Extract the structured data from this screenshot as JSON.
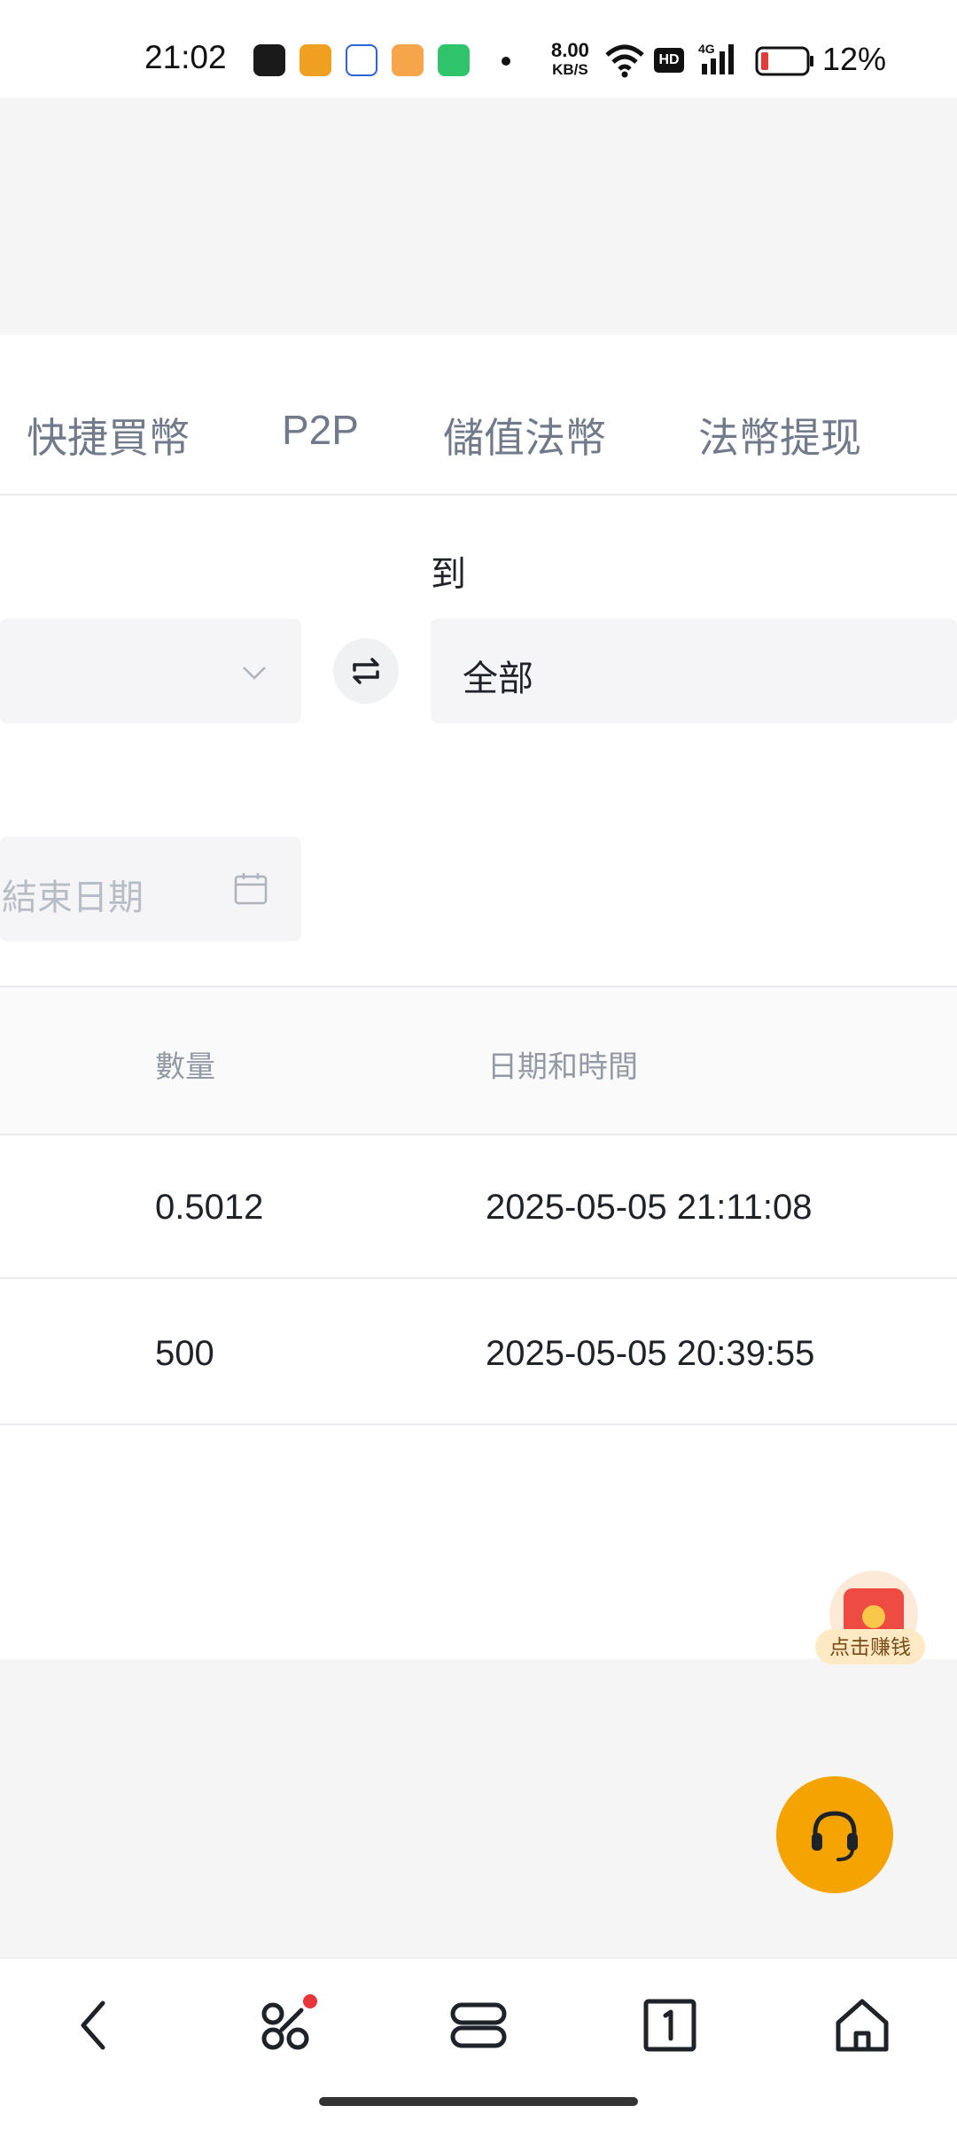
{
  "status_bar": {
    "time": "21:02",
    "net_speed_value": "8.00",
    "net_speed_unit": "KB/S",
    "battery_percent": "12%",
    "icons": [
      "app-icon-a",
      "app-icon-imou",
      "app-icon-c",
      "app-icon-video",
      "app-icon-battery-saver",
      "wifi-icon",
      "hd-icon",
      "4g-signal-icon",
      "battery-icon"
    ]
  },
  "tabs": [
    {
      "label": "快捷買幣"
    },
    {
      "label": "P2P"
    },
    {
      "label": "儲值法幣"
    },
    {
      "label": "法幣提现"
    }
  ],
  "form": {
    "to_label": "到",
    "to_value": "全部",
    "end_date_placeholder": "結束日期"
  },
  "table": {
    "headers": {
      "amount": "數量",
      "datetime": "日期和時間"
    },
    "rows": [
      {
        "amount": "0.5012",
        "datetime": "2025-05-05 21:11:08"
      },
      {
        "amount": "500",
        "datetime": "2025-05-05 20:39:55"
      }
    ]
  },
  "floating": {
    "earn_label": "点击赚钱"
  },
  "colors": {
    "accent": "#f5a300",
    "text_primary": "#1e2329",
    "text_secondary": "#707a8a",
    "placeholder": "#b7bdc6",
    "notification_dot": "#e8353b"
  }
}
